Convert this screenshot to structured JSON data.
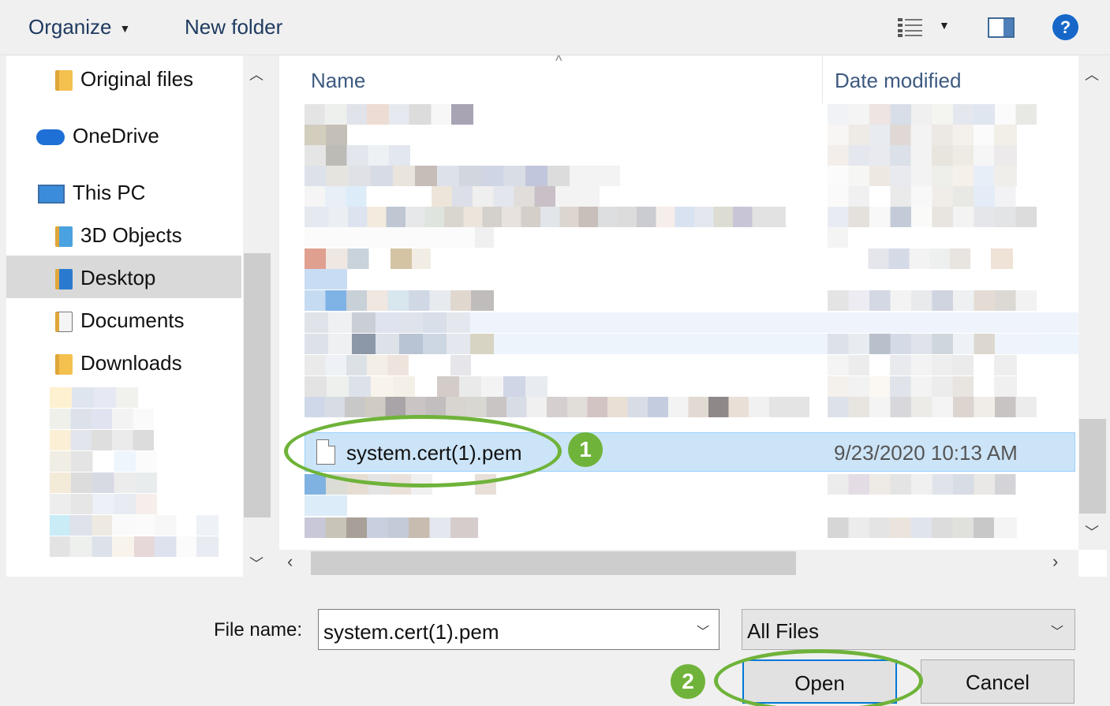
{
  "toolbar": {
    "organize_label": "Organize",
    "new_folder_label": "New folder",
    "help_label": "?"
  },
  "nav": {
    "items": [
      {
        "label": "Original files",
        "icon": "folder-icon"
      },
      {
        "label": "OneDrive",
        "icon": "onedrive-icon"
      },
      {
        "label": "This PC",
        "icon": "pc-icon"
      },
      {
        "label": "3D Objects",
        "icon": "3d-objects-icon"
      },
      {
        "label": "Desktop",
        "icon": "desktop-icon",
        "selected": true
      },
      {
        "label": "Documents",
        "icon": "documents-icon"
      },
      {
        "label": "Downloads",
        "icon": "downloads-icon"
      }
    ]
  },
  "list": {
    "columns": {
      "name": "Name",
      "date_modified": "Date modified"
    },
    "selected_file": {
      "name": "system.cert(1).pem",
      "date": "9/23/2020 10:13 AM"
    }
  },
  "bottom": {
    "file_name_label": "File name:",
    "file_name_value": "system.cert(1).pem",
    "file_type_value": "All Files",
    "open_label": "Open",
    "cancel_label": "Cancel"
  },
  "annotations": {
    "step1": "1",
    "step2": "2"
  },
  "colors": {
    "accent_ring": "#6fb33a",
    "selection": "#cce4f7",
    "focus_border": "#0078d7"
  }
}
